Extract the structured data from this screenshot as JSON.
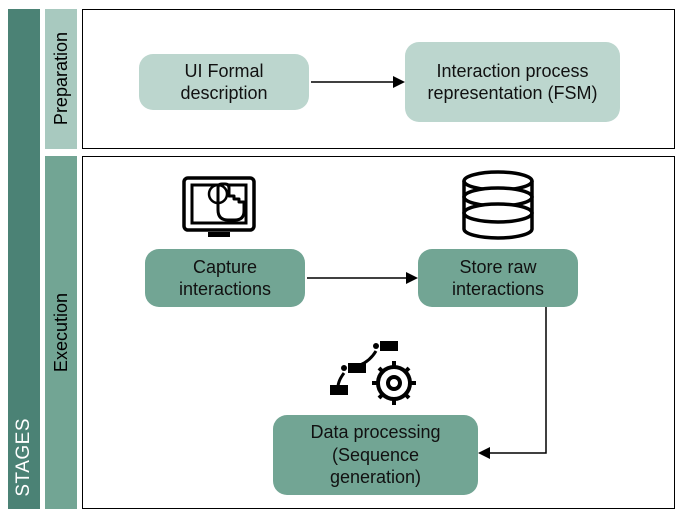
{
  "stages_label": "STAGES",
  "phases": {
    "preparation": "Preparation",
    "execution": "Execution"
  },
  "nodes": {
    "ui_formal": "UI Formal description",
    "fsm": "Interaction process representation (FSM)",
    "capture": "Capture interactions",
    "store": "Store raw interactions",
    "processing": "Data processing (Sequence generation)"
  },
  "colors": {
    "stages_bar": "#4b8275",
    "light_node": "#bcd6ce",
    "dark_node": "#72a594"
  }
}
